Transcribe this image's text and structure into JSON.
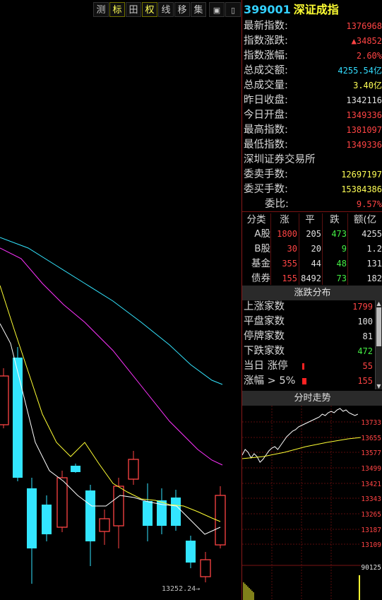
{
  "toolbar": {
    "buttons": [
      {
        "label": "测",
        "icon": ""
      },
      {
        "label": "标",
        "icon": ""
      },
      {
        "label": "田",
        "icon": "grid-icon"
      },
      {
        "label": "权",
        "icon": ""
      },
      {
        "label": "线",
        "icon": ""
      },
      {
        "label": "移",
        "icon": ""
      },
      {
        "label": "集",
        "icon": ""
      },
      {
        "label": "▣",
        "icon": "window-icon"
      },
      {
        "label": "▯",
        "icon": "panel-toggle-icon"
      }
    ]
  },
  "chart": {
    "low_label": "13252.24"
  },
  "quote": {
    "code": "399001",
    "name": "深证成指",
    "rows": [
      {
        "label": "最新指数:",
        "value": "1376968",
        "color": "red"
      },
      {
        "label": "指数涨跌:",
        "value": "▲34852",
        "color": "red"
      },
      {
        "label": "指数涨幅:",
        "value": "2.60%",
        "color": "red"
      },
      {
        "label": "总成交额:",
        "value": "4255.54亿",
        "color": "cyan"
      },
      {
        "label": "总成交量:",
        "value": "3.40亿",
        "color": "yellow"
      },
      {
        "label": "昨日收盘:",
        "value": "1342116",
        "color": "white"
      },
      {
        "label": "今日开盘:",
        "value": "1349336",
        "color": "red"
      },
      {
        "label": "最高指数:",
        "value": "1381097",
        "color": "red"
      },
      {
        "label": "最低指数:",
        "value": "1349336",
        "color": "red"
      }
    ],
    "exchange": "深圳证券交易所",
    "rows2": [
      {
        "label": "委卖手数:",
        "value": "12697197",
        "color": "yellow"
      },
      {
        "label": "委买手数:",
        "value": "15384386",
        "color": "yellow"
      },
      {
        "label": "委比:",
        "value": "9.57%",
        "color": "red"
      }
    ]
  },
  "categories": {
    "header": [
      "分类",
      "涨",
      "平",
      "跌",
      "额(亿"
    ],
    "rows": [
      {
        "name": "A股",
        "up": "1800",
        "flat": "205",
        "down": "473",
        "amount": "4255"
      },
      {
        "name": "B股",
        "up": "30",
        "flat": "20",
        "down": "9",
        "amount": "1.2"
      },
      {
        "name": "基金",
        "up": "355",
        "flat": "44",
        "down": "48",
        "amount": "131"
      },
      {
        "name": "债券",
        "up": "155",
        "flat": "8492",
        "down": "73",
        "amount": "182"
      }
    ]
  },
  "distribution": {
    "title": "涨跌分布",
    "rows": [
      {
        "label": "上涨家数",
        "value": "1799",
        "color": "red"
      },
      {
        "label": "平盘家数",
        "value": "100",
        "color": "white"
      },
      {
        "label": "停牌家数",
        "value": "81",
        "color": "white"
      },
      {
        "label": "下跌家数",
        "value": "472",
        "color": "green"
      },
      {
        "label": "当日 涨停",
        "value": "55",
        "color": "red"
      },
      {
        "label": "涨幅 > 5%",
        "value": "155",
        "color": "red"
      }
    ]
  },
  "intraday": {
    "title": "分时走势",
    "price_labels": [
      "13733",
      "13655",
      "13577",
      "13499",
      "13421",
      "13343",
      "13265",
      "13187",
      "13109"
    ],
    "volume_label": "90125"
  },
  "colors": {
    "up": "#ff4444",
    "down": "#33e5ff",
    "ma5": "#ffffff",
    "ma10": "#ffff33",
    "ma20": "#ff33ff",
    "ma60": "#33e5ff"
  }
}
